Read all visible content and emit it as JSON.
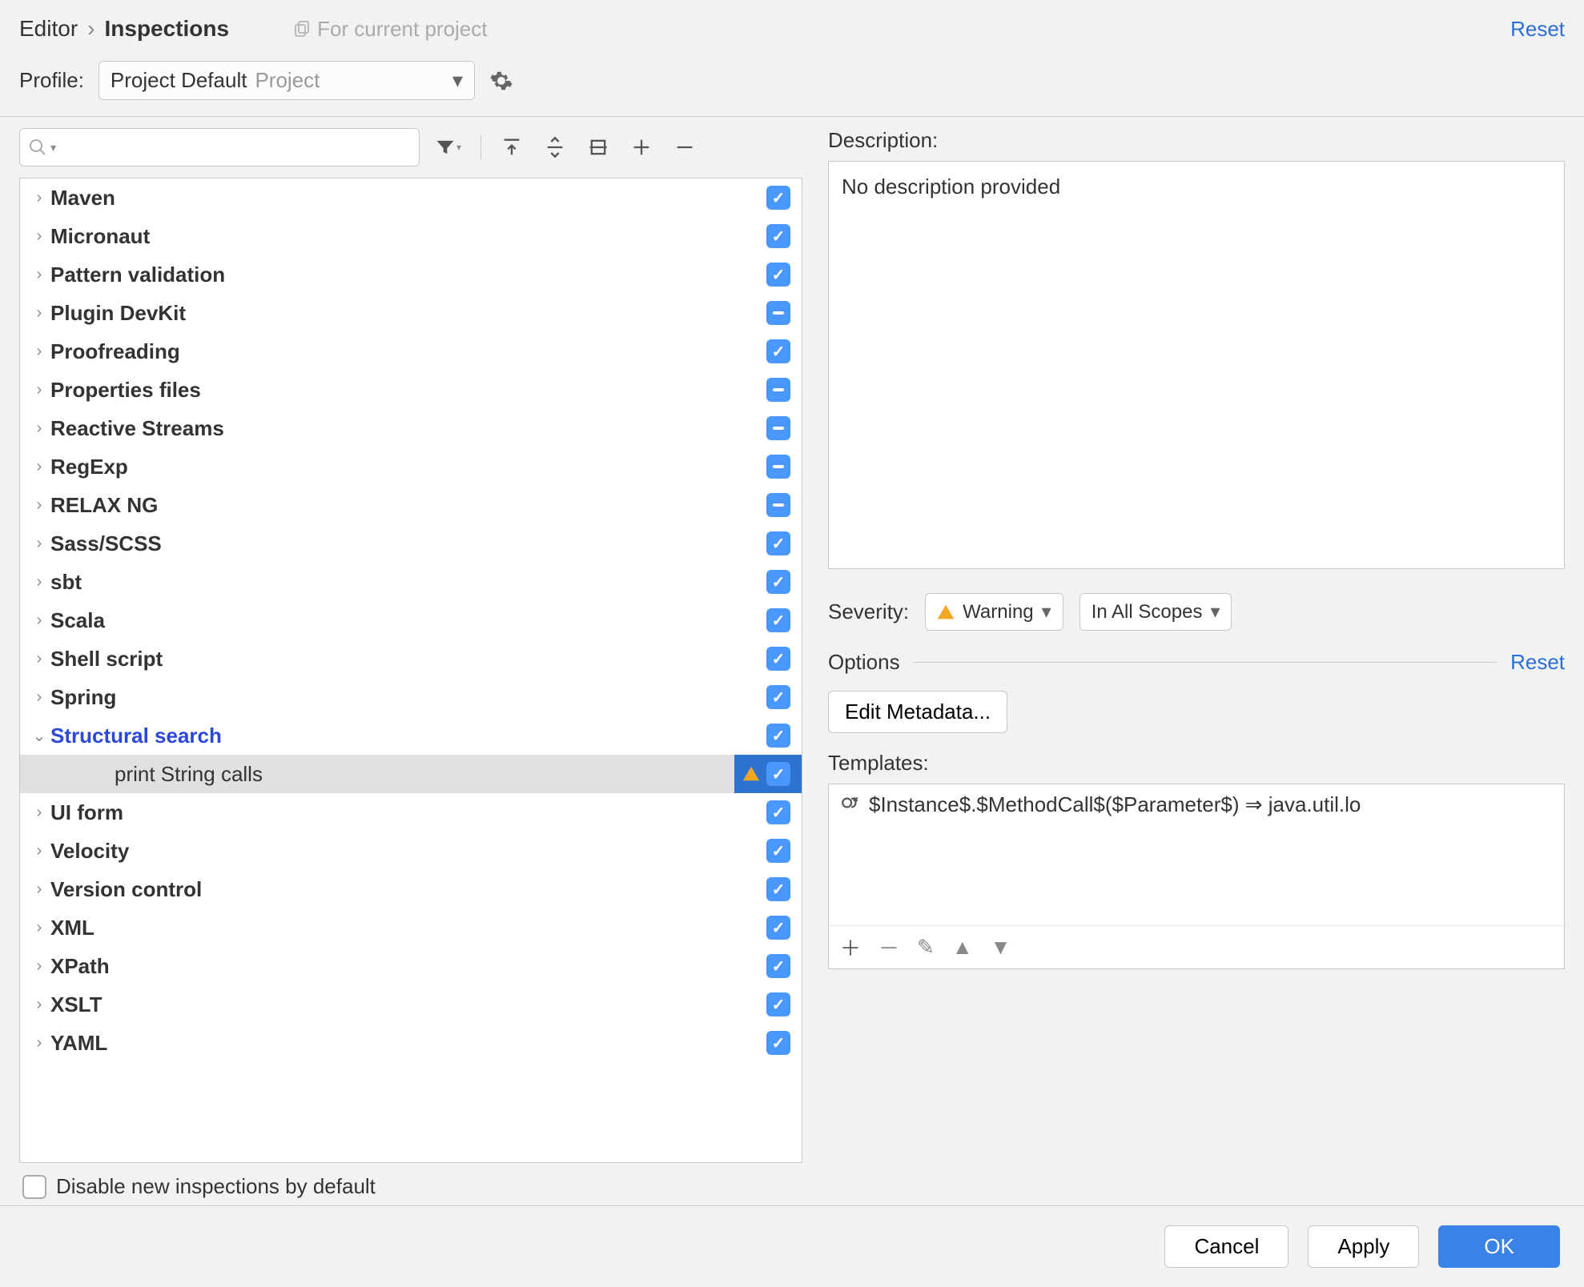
{
  "breadcrumb": {
    "parent": "Editor",
    "current": "Inspections"
  },
  "copy_hint": "For current project",
  "reset_label": "Reset",
  "profile": {
    "label": "Profile:",
    "name": "Project Default",
    "scope": "Project"
  },
  "description": {
    "label": "Description:",
    "text": "No description provided"
  },
  "severity": {
    "label": "Severity:",
    "value": "Warning",
    "scope": "In All Scopes"
  },
  "options": {
    "title": "Options",
    "reset": "Reset",
    "edit_metadata": "Edit Metadata..."
  },
  "templates": {
    "label": "Templates:",
    "item": "$Instance$.$MethodCall$($Parameter$) ⇒ java.util.lo"
  },
  "disable_label": "Disable new inspections by default",
  "buttons": {
    "cancel": "Cancel",
    "apply": "Apply",
    "ok": "OK"
  },
  "tree": [
    {
      "label": "Maven",
      "state": "checked",
      "expander": ">"
    },
    {
      "label": "Micronaut",
      "state": "checked",
      "expander": ">"
    },
    {
      "label": "Pattern validation",
      "state": "checked",
      "expander": ">"
    },
    {
      "label": "Plugin DevKit",
      "state": "partial",
      "expander": ">"
    },
    {
      "label": "Proofreading",
      "state": "checked",
      "expander": ">"
    },
    {
      "label": "Properties files",
      "state": "partial",
      "expander": ">"
    },
    {
      "label": "Reactive Streams",
      "state": "partial",
      "expander": ">"
    },
    {
      "label": "RegExp",
      "state": "partial",
      "expander": ">"
    },
    {
      "label": "RELAX NG",
      "state": "partial",
      "expander": ">"
    },
    {
      "label": "Sass/SCSS",
      "state": "checked",
      "expander": ">"
    },
    {
      "label": "sbt",
      "state": "checked",
      "expander": ">"
    },
    {
      "label": "Scala",
      "state": "checked",
      "expander": ">"
    },
    {
      "label": "Shell script",
      "state": "checked",
      "expander": ">"
    },
    {
      "label": "Spring",
      "state": "checked",
      "expander": ">"
    },
    {
      "label": "Structural search",
      "state": "checked",
      "expander": "v",
      "structural": true
    },
    {
      "label": "print String calls",
      "state": "checked",
      "expander": "",
      "child": true,
      "selected": true,
      "warn": true
    },
    {
      "label": "UI form",
      "state": "checked",
      "expander": ">"
    },
    {
      "label": "Velocity",
      "state": "checked",
      "expander": ">"
    },
    {
      "label": "Version control",
      "state": "checked",
      "expander": ">"
    },
    {
      "label": "XML",
      "state": "checked",
      "expander": ">"
    },
    {
      "label": "XPath",
      "state": "checked",
      "expander": ">"
    },
    {
      "label": "XSLT",
      "state": "checked",
      "expander": ">"
    },
    {
      "label": "YAML",
      "state": "checked",
      "expander": ">"
    }
  ]
}
